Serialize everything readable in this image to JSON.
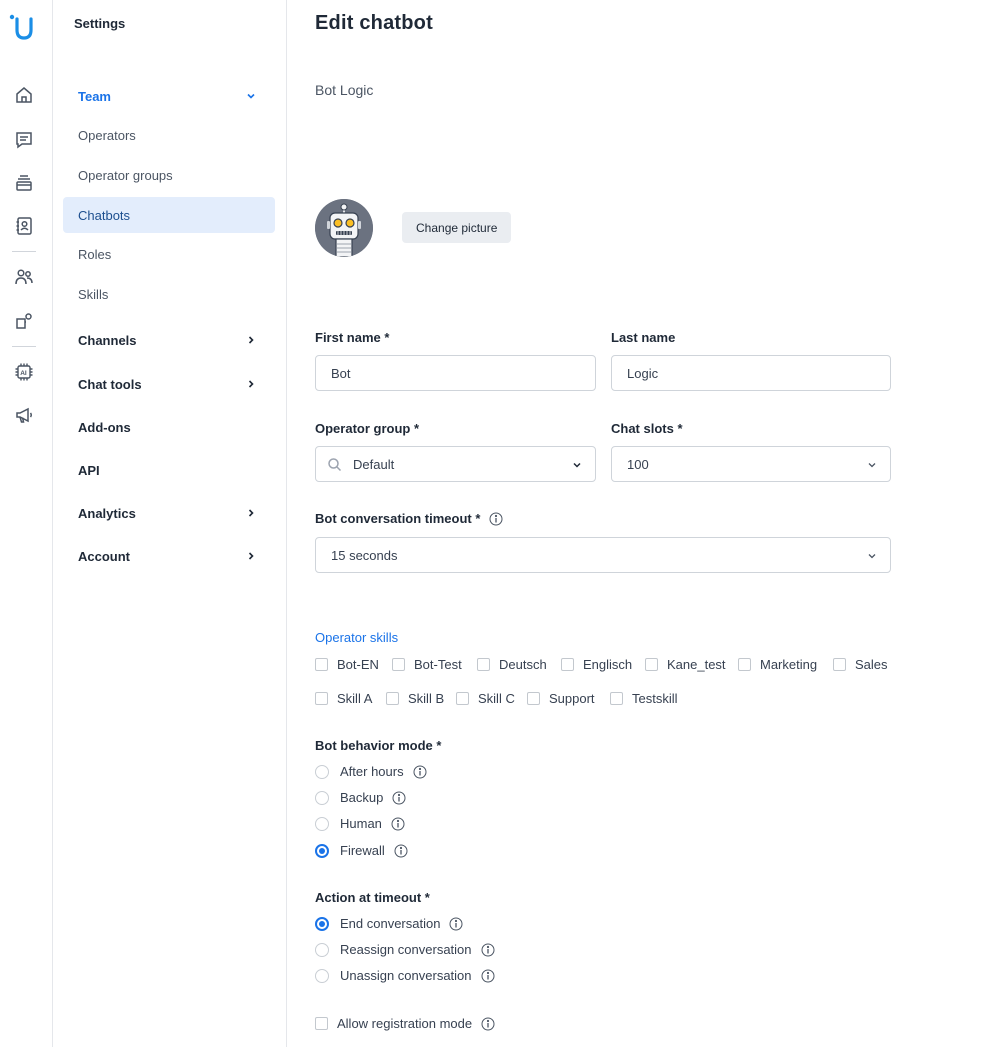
{
  "sidebar": {
    "title": "Settings",
    "team": "Team",
    "items": [
      "Operators",
      "Operator groups",
      "Chatbots",
      "Roles",
      "Skills"
    ],
    "groups": [
      "Channels",
      "Chat tools",
      "Add-ons",
      "API",
      "Analytics",
      "Account"
    ]
  },
  "rail_icons": [
    "home-icon",
    "chat-icon",
    "inbox-icon",
    "contacts-icon",
    "team-icon",
    "apps-icon",
    "ai-chip-icon",
    "megaphone-icon"
  ],
  "main": {
    "title": "Edit chatbot",
    "subtitle": "Bot Logic",
    "change_picture": "Change picture",
    "first_name_label": "First name *",
    "first_name_value": "Bot",
    "last_name_label": "Last name",
    "last_name_value": "Logic",
    "operator_group_label": "Operator group *",
    "operator_group_value": "Default",
    "chat_slots_label": "Chat slots *",
    "chat_slots_value": "100",
    "timeout_label": "Bot conversation timeout *",
    "timeout_value": "15 seconds",
    "skills_label": "Operator skills",
    "skills": [
      "Bot-EN",
      "Bot-Test",
      "Deutsch",
      "Englisch",
      "Kane_test",
      "Marketing",
      "Sales",
      "Skill A",
      "Skill B",
      "Skill C",
      "Support",
      "Testskill"
    ],
    "behavior_label": "Bot behavior mode *",
    "behavior_options": [
      "After hours",
      "Backup",
      "Human",
      "Firewall"
    ],
    "behavior_selected": "Firewall",
    "action_label": "Action at timeout *",
    "action_options": [
      "End conversation",
      "Reassign conversation",
      "Unassign conversation"
    ],
    "action_selected": "End conversation",
    "registration_label": "Allow registration mode"
  },
  "colors": {
    "accent": "#1a73e8",
    "active_bg": "#e3edfc",
    "logo": "#1b8ee6"
  }
}
